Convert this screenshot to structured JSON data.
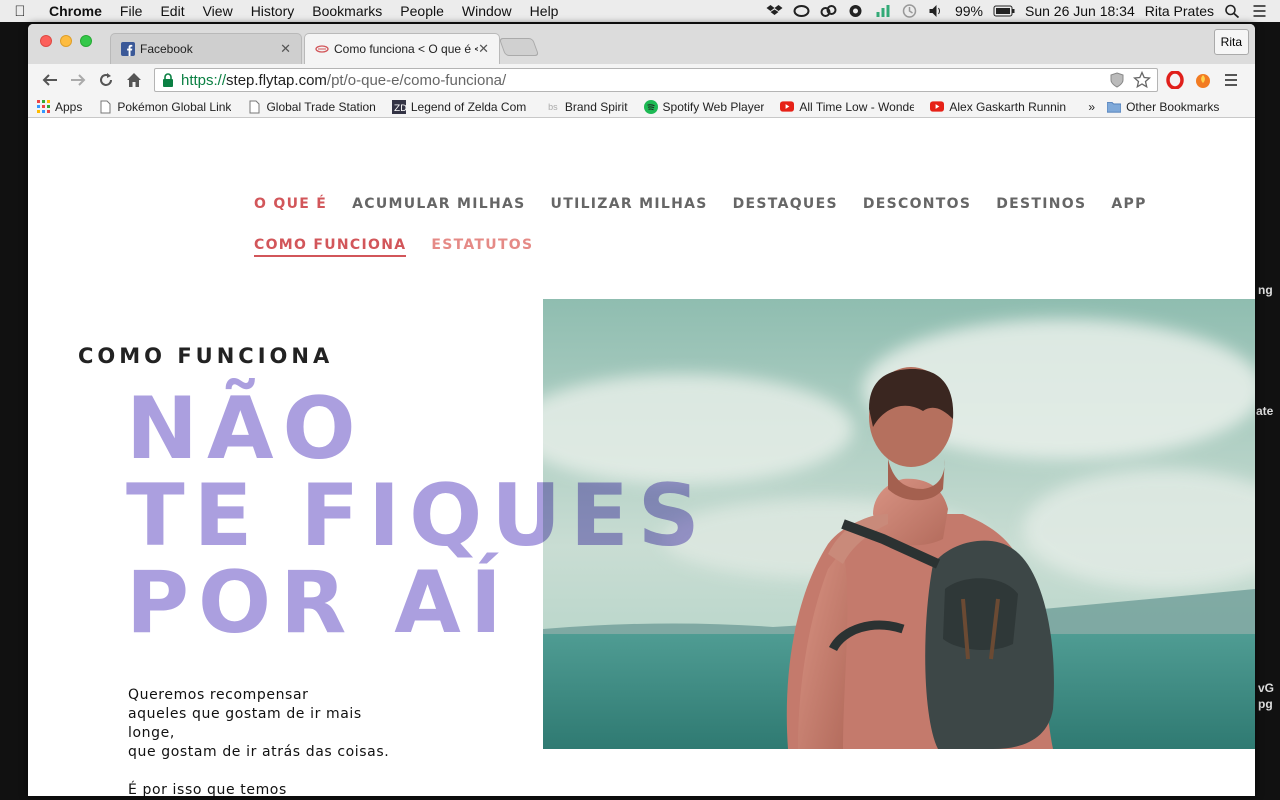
{
  "menubar": {
    "app": "Chrome",
    "items": [
      "File",
      "Edit",
      "View",
      "History",
      "Bookmarks",
      "People",
      "Window",
      "Help"
    ],
    "battery": "99%",
    "datetime": "Sun 26 Jun  18:34",
    "user": "Rita Prates"
  },
  "desktop": {
    "peek": [
      "ng",
      "ate",
      "vG",
      "pg"
    ]
  },
  "tabs": [
    {
      "title": "Facebook",
      "icon": "facebook-icon"
    },
    {
      "title": "Como funciona < O que é <",
      "icon": "flytap-icon"
    }
  ],
  "profile": "Rita",
  "url": {
    "scheme": "https://",
    "host": "step.flytap.com",
    "path": "/pt/o-que-e/como-funciona/"
  },
  "bookmarks": [
    {
      "label": "Apps",
      "icon": "apps-grid-icon"
    },
    {
      "label": "Pokémon Global Link",
      "icon": "page-icon"
    },
    {
      "label": "Global Trade Station",
      "icon": "page-icon"
    },
    {
      "label": "Legend of Zelda Com",
      "icon": "zelda-icon"
    },
    {
      "label": "Brand Spirit",
      "icon": "bs-icon"
    },
    {
      "label": "Spotify Web Player",
      "icon": "spotify-icon"
    },
    {
      "label": "All Time Low - Wonde",
      "icon": "youtube-icon"
    },
    {
      "label": "Alex Gaskarth Runnin",
      "icon": "youtube-icon"
    }
  ],
  "bookmarks_more": "»",
  "other_bookmarks": "Other Bookmarks",
  "nav": {
    "main": [
      "O QUE É",
      "ACUMULAR MILHAS",
      "UTILIZAR MILHAS",
      "DESTAQUES",
      "DESCONTOS",
      "DESTINOS",
      "APP"
    ],
    "sub": [
      "COMO FUNCIONA",
      "ESTATUTOS"
    ]
  },
  "content": {
    "label": "COMO FUNCIONA",
    "headline": [
      "NÃO",
      "TE FIQUES",
      "POR AÍ"
    ],
    "body": [
      "Queremos recompensar",
      "aqueles que gostam de ir mais",
      "longe,",
      "que gostam de ir atrás das coisas.",
      "É por isso que temos"
    ]
  },
  "colors": {
    "accent": "#d2565a",
    "headline": "#ab9fdf",
    "url_secure": "#0b8043"
  }
}
